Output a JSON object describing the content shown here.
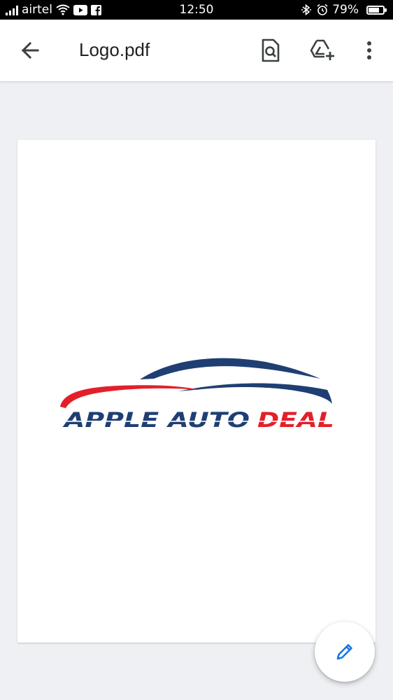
{
  "status_bar": {
    "carrier": "airtel",
    "time": "12:50",
    "battery": "79%",
    "battery_level": 0.79,
    "icons": [
      "signal-icon",
      "wifi-icon",
      "youtube-icon",
      "facebook-icon",
      "bluetooth-icon",
      "alarm-icon",
      "battery-icon"
    ]
  },
  "app_bar": {
    "title": "Logo.pdf",
    "icons": [
      "back-arrow-icon",
      "search-in-document-icon",
      "add-to-drive-icon",
      "more-vert-icon"
    ]
  },
  "document": {
    "logo_text": {
      "part1": "APPLE AUTO",
      "part2": "DEAL"
    },
    "colors": {
      "navy": "#1f3f73",
      "red": "#e3202a"
    }
  },
  "fab": {
    "icon": "edit-pencil-icon",
    "color": "#1a73e8"
  }
}
